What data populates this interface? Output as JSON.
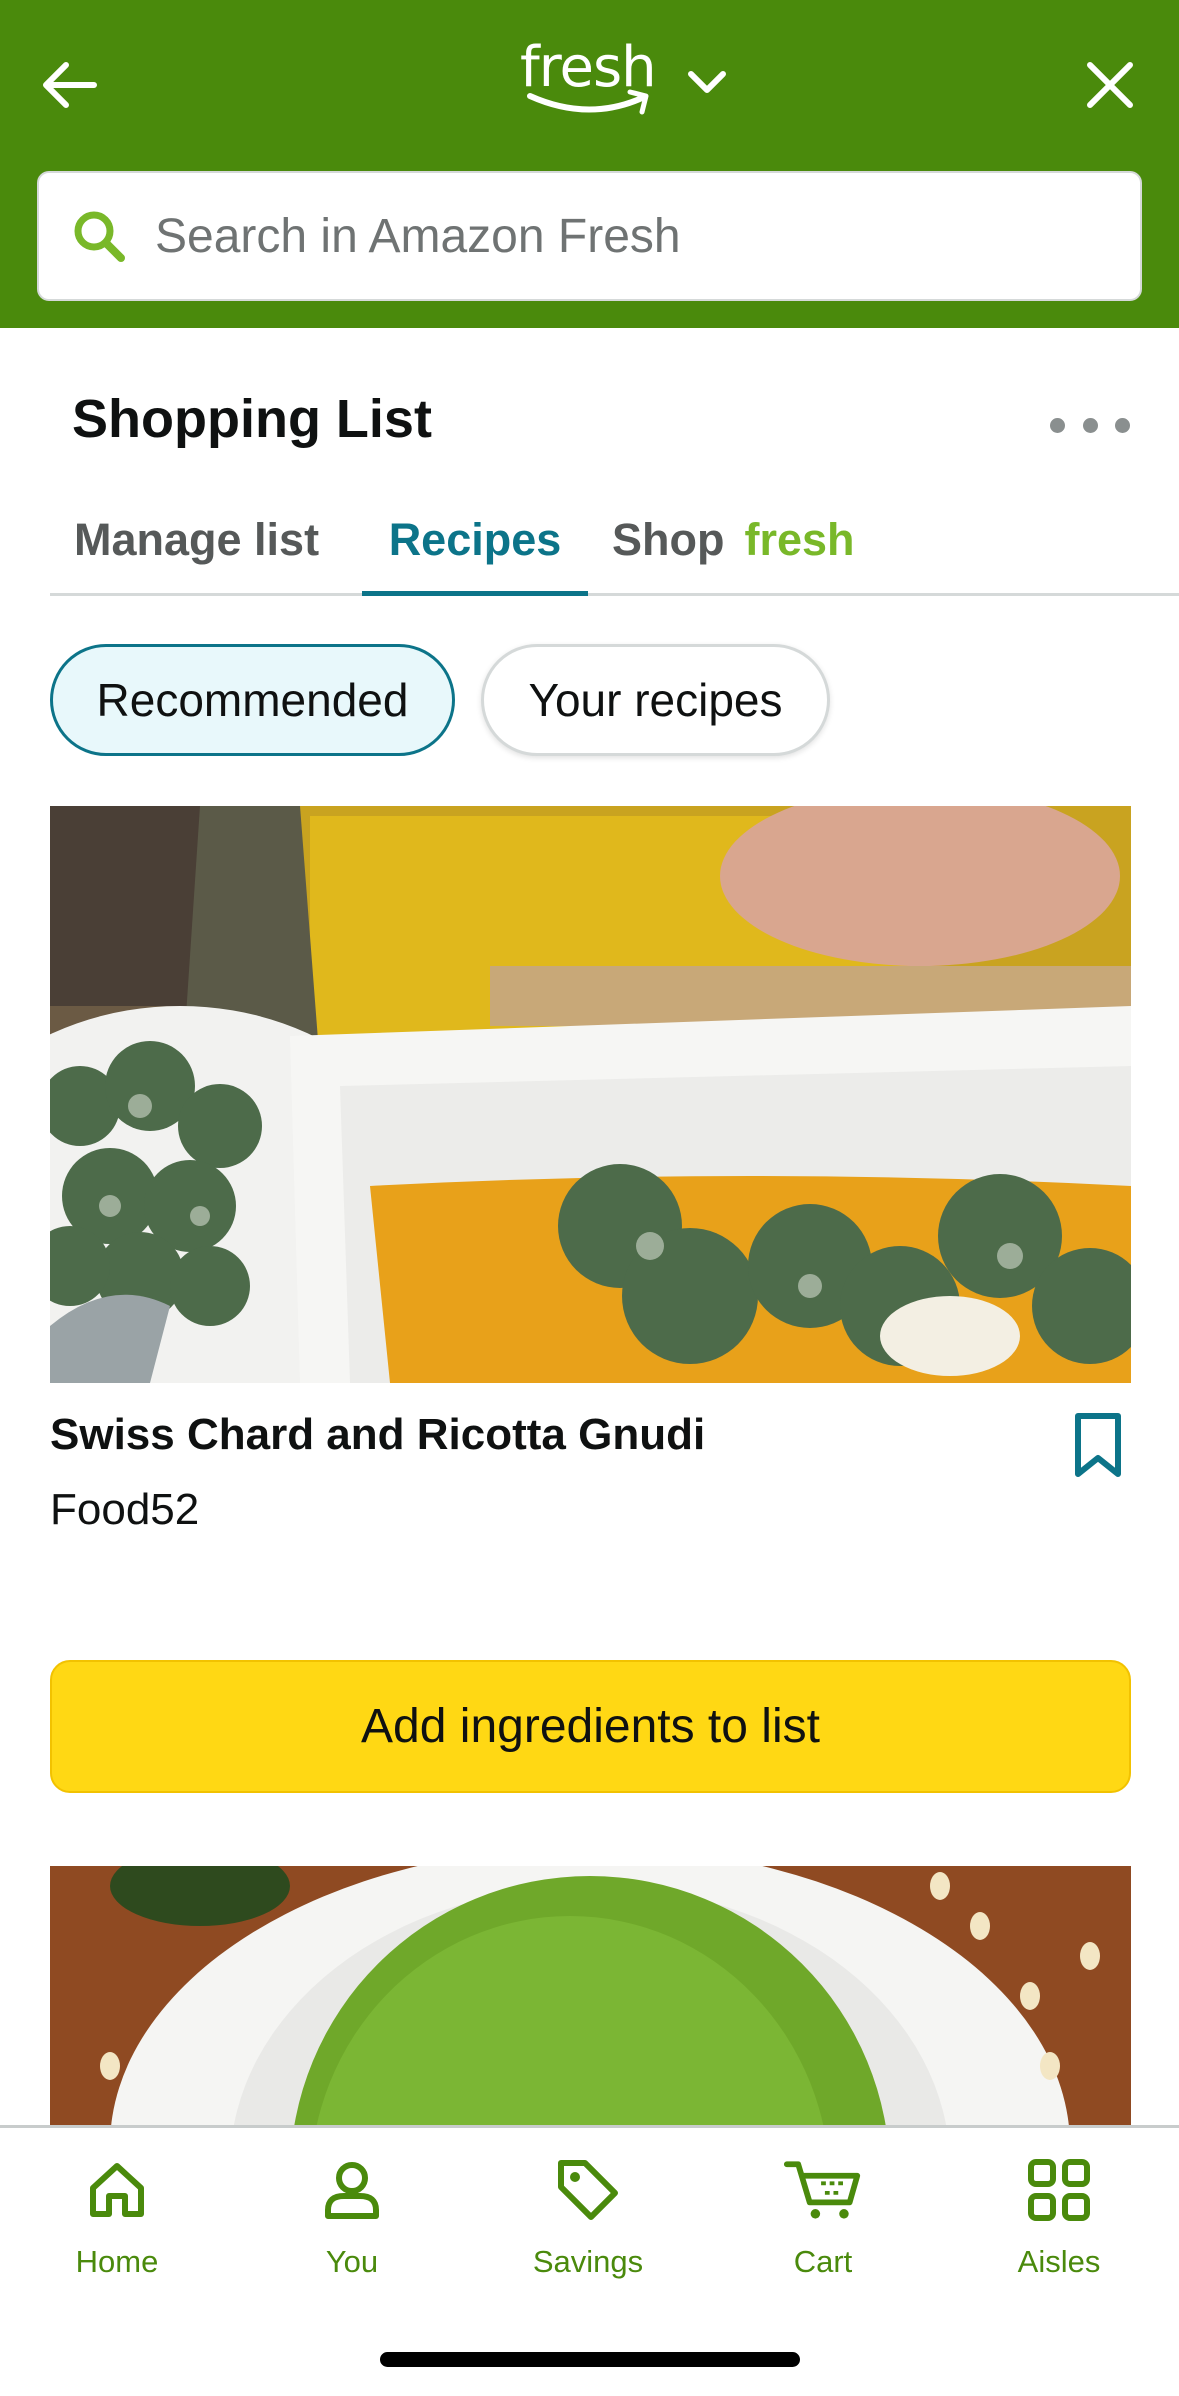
{
  "header": {
    "logo_text": "fresh",
    "search_placeholder": "Search in Amazon Fresh",
    "colors": {
      "background": "#4a8a0c",
      "accent": "#79b829"
    }
  },
  "page": {
    "title": "Shopping List"
  },
  "tabs": [
    {
      "label": "Manage list",
      "active": false
    },
    {
      "label": "Recipes",
      "active": true
    },
    {
      "label": "Shop",
      "suffix": "fresh",
      "active": false
    }
  ],
  "filters": [
    {
      "label": "Recommended",
      "selected": true
    },
    {
      "label": "Your recipes",
      "selected": false
    }
  ],
  "recipes": [
    {
      "title": "Swiss Chard and Ricotta Gnudi",
      "source": "Food52",
      "action_label": "Add ingredients to list"
    }
  ],
  "bottom_nav": [
    {
      "label": "Home",
      "icon": "home-icon"
    },
    {
      "label": "You",
      "icon": "person-icon"
    },
    {
      "label": "Savings",
      "icon": "tag-icon"
    },
    {
      "label": "Cart",
      "icon": "cart-icon"
    },
    {
      "label": "Aisles",
      "icon": "grid-icon"
    }
  ]
}
